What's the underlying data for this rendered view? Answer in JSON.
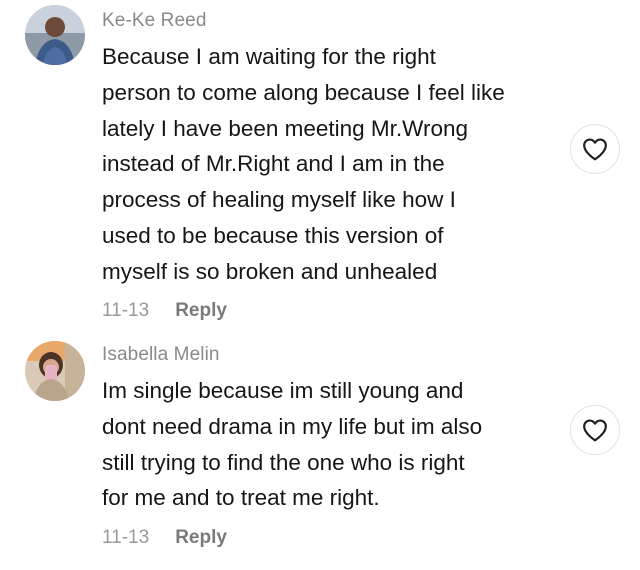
{
  "comments": [
    {
      "username": "Ke-Ke Reed",
      "lines": [
        "Because I am waiting for the right",
        "person to come along because I feel like",
        "lately I have been meeting Mr.Wrong",
        "instead of Mr.Right and I am in the",
        "process of healing myself like how I",
        "used to be because this version of",
        "myself is so broken and unhealed"
      ],
      "date": "11-13",
      "reply_label": "Reply",
      "avatar_icon": "user-avatar",
      "like_icon": "heart-icon"
    },
    {
      "username": "Isabella Melin",
      "lines": [
        "Im single because im still young and",
        "dont need drama in my life but im also",
        "still trying to find the one who is right",
        "for me and to treat me right."
      ],
      "date": "11-13",
      "reply_label": "Reply",
      "avatar_icon": "user-avatar",
      "like_icon": "heart-icon"
    }
  ],
  "colors": {
    "username": "#8a8a8a",
    "text": "#161616",
    "date": "#9a9a9a",
    "reply": "#7a7a7a",
    "like_border": "#e2e2e2"
  }
}
